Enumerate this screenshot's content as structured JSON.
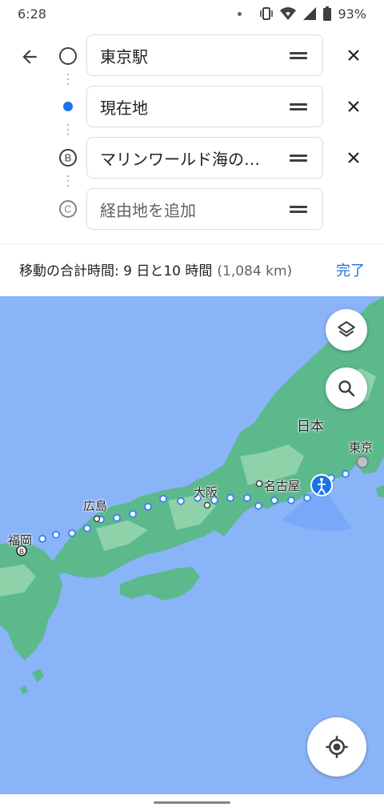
{
  "status_bar": {
    "time": "6:28",
    "battery": "93%"
  },
  "stops": [
    {
      "label": "東京駅",
      "marker": "empty-circle",
      "placeholder": false,
      "removable": true
    },
    {
      "label": "現在地",
      "marker": "current-location-dot",
      "placeholder": false,
      "removable": true
    },
    {
      "label": "マリンワールド海の…",
      "marker": "B",
      "placeholder": false,
      "removable": true
    },
    {
      "label": "経由地を追加",
      "marker": "C",
      "placeholder": true,
      "removable": false
    }
  ],
  "summary": {
    "total_time": "移動の合計時間: 9 日と10 時間",
    "distance": "(1,084 km)",
    "done_label": "完了"
  },
  "map": {
    "labels": {
      "japan": "日本",
      "tokyo": "東京",
      "nagoya": "名古屋",
      "osaka": "大阪",
      "hiroshima": "広島",
      "fukuoka": "福岡"
    },
    "colors": {
      "water": "#8ab4f8",
      "land": "#5bb98c",
      "route": "#4285f4",
      "current_location": "#1a73e8"
    }
  }
}
